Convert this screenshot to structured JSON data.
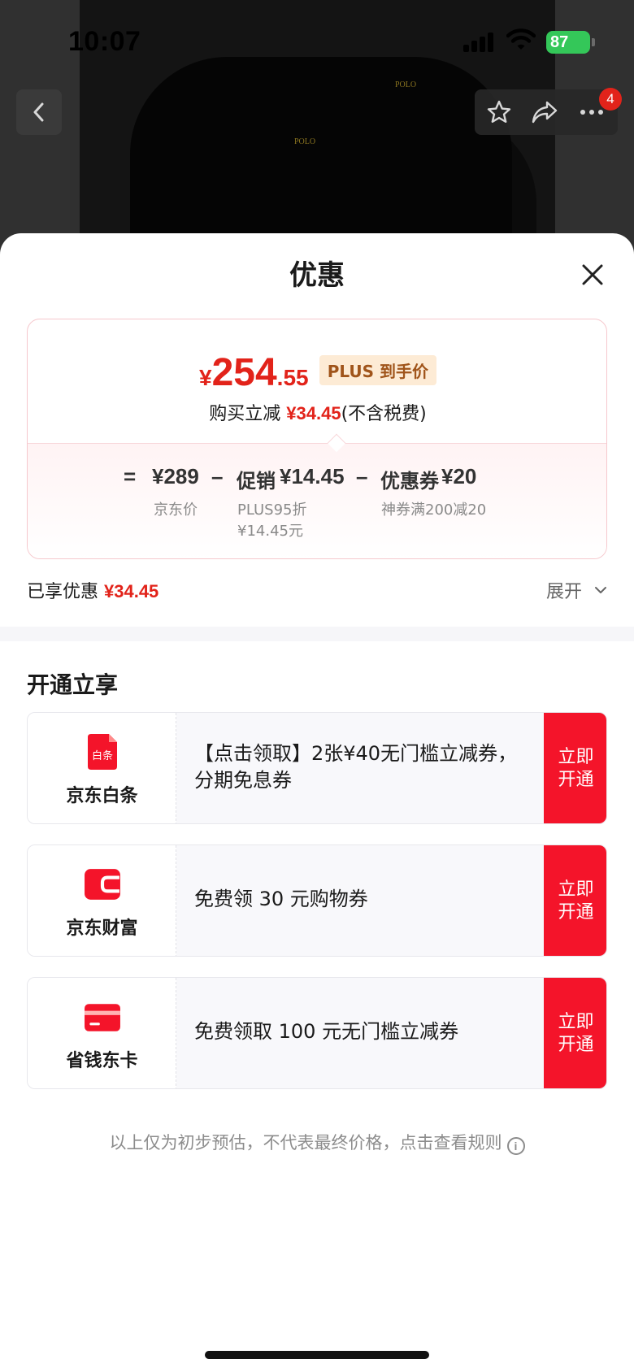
{
  "status_bar": {
    "time": "10:07",
    "battery": "87"
  },
  "header": {
    "notification_count": "4",
    "logo_text": "POLO"
  },
  "sheet": {
    "title": "优惠",
    "price": {
      "currency": "¥",
      "integer": "254",
      "decimal": ".55",
      "plus_tag": "PLUS 到手价",
      "reduce_prefix": "购买立减 ",
      "reduce_amount": "¥34.45",
      "reduce_suffix": "(不含税费)"
    },
    "formula": {
      "equals": "=",
      "base_value": "¥289",
      "base_label": "京东价",
      "minus1": "–",
      "promo_name": "促销",
      "promo_value": "¥14.45",
      "promo_desc_1": "PLUS95折",
      "promo_desc_2": "¥14.45元",
      "minus2": "–",
      "coupon_name": "优惠券",
      "coupon_value": "¥20",
      "coupon_desc": "神券满200减20"
    },
    "enjoyed": {
      "label": "已享优惠 ",
      "amount": "¥34.45",
      "expand": "展开"
    },
    "section_title": "开通立享",
    "offers": [
      {
        "brand": "京东白条",
        "icon_text": "白条",
        "desc": "【点击领取】2张¥40无门槛立减券，分期免息券",
        "cta": "立即开通",
        "icon": "baitiao-icon",
        "color": "#f4142a"
      },
      {
        "brand": "京东财富",
        "desc": "免费领 30 元购物券",
        "cta": "立即开通",
        "icon": "wallet-icon",
        "color": "#f4142a"
      },
      {
        "brand": "省钱东卡",
        "desc": "免费领取 100 元无门槛立减券",
        "cta": "立即开通",
        "icon": "card-icon",
        "color": "#f4142a"
      }
    ],
    "disclaimer": "以上仅为初步预估，不代表最终价格，点击查看规则",
    "info_glyph": "i"
  }
}
